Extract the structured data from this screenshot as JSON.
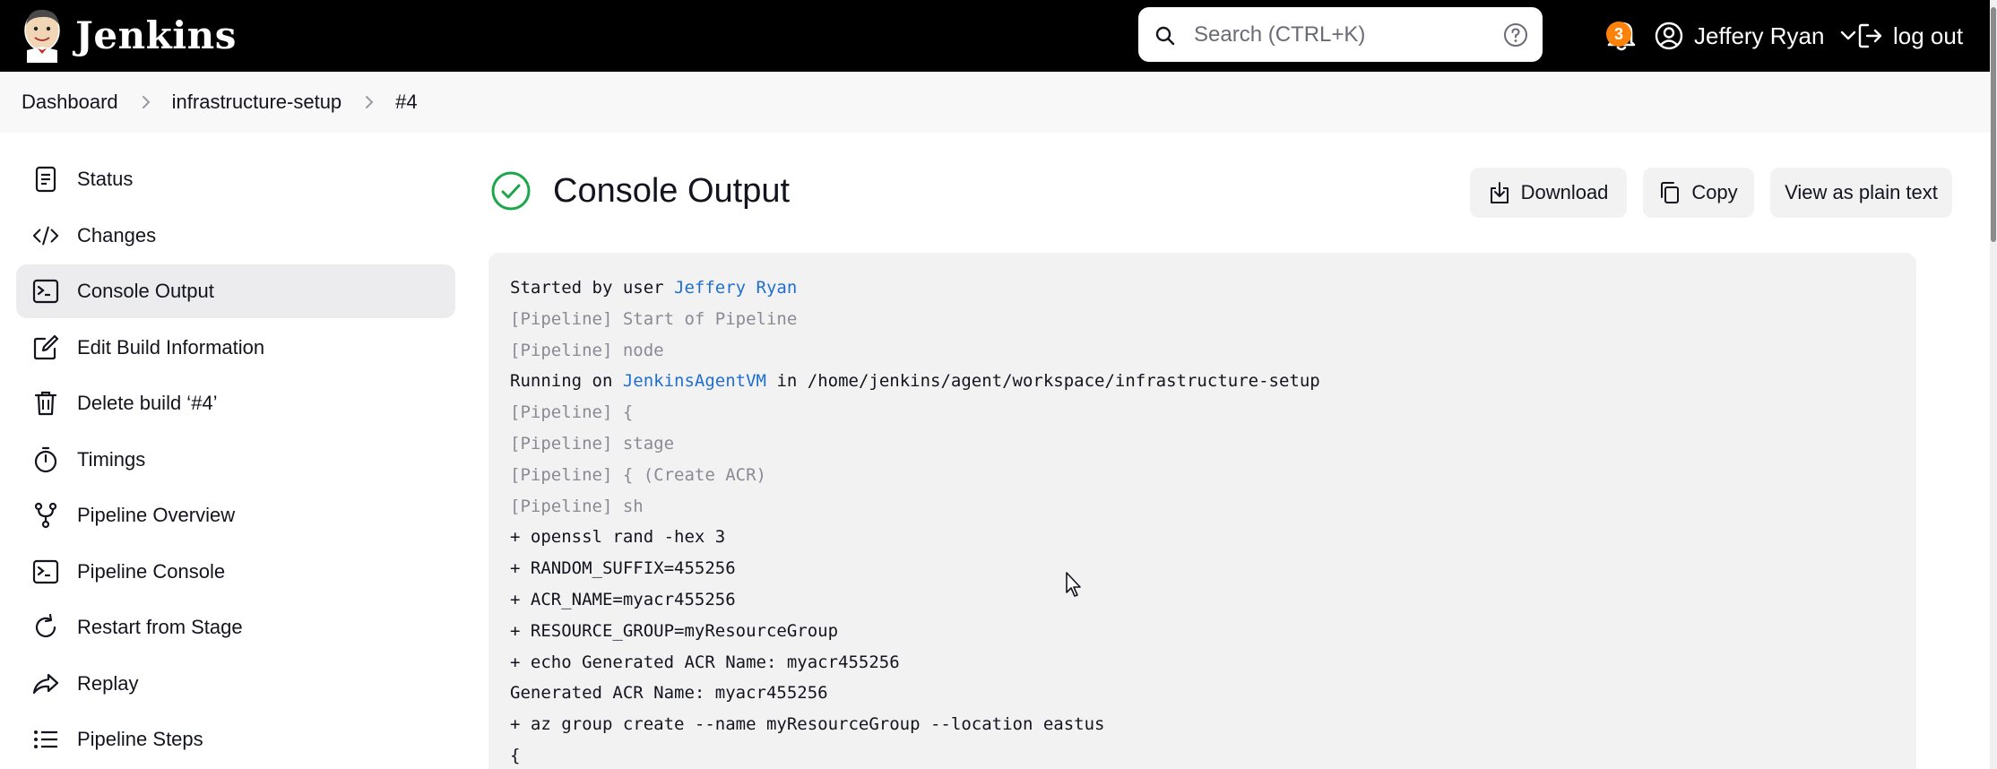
{
  "header": {
    "logo_text": "Jenkins",
    "search_placeholder": "Search (CTRL+K)",
    "notification_count": "3",
    "user_name": "Jeffery Ryan",
    "logout_label": "log out",
    "badge_color": "#fe820a"
  },
  "breadcrumb": [
    {
      "label": "Dashboard"
    },
    {
      "label": "infrastructure-setup"
    },
    {
      "label": "#4"
    }
  ],
  "sidebar": {
    "items": [
      {
        "label": "Status",
        "icon": "document-icon"
      },
      {
        "label": "Changes",
        "icon": "code-icon"
      },
      {
        "label": "Console Output",
        "icon": "terminal-icon",
        "active": true
      },
      {
        "label": "Edit Build Information",
        "icon": "edit-icon"
      },
      {
        "label": "Delete build ‘#4’",
        "icon": "trash-icon"
      },
      {
        "label": "Timings",
        "icon": "stopwatch-icon"
      },
      {
        "label": "Pipeline Overview",
        "icon": "branch-icon"
      },
      {
        "label": "Pipeline Console",
        "icon": "terminal-icon"
      },
      {
        "label": "Restart from Stage",
        "icon": "restart-icon"
      },
      {
        "label": "Replay",
        "icon": "replay-icon"
      },
      {
        "label": "Pipeline Steps",
        "icon": "list-icon"
      }
    ]
  },
  "main": {
    "title": "Console Output",
    "status": "success",
    "status_color": "#1ea64b",
    "buttons": {
      "download": "Download",
      "copy": "Copy",
      "plain_text": "View as plain text"
    }
  },
  "console": {
    "lines": [
      {
        "pre": "Started by user ",
        "link": "Jeffery Ryan",
        "post": "",
        "muted": false
      },
      {
        "pre": "[Pipeline] Start of Pipeline",
        "link": "",
        "post": "",
        "muted": true
      },
      {
        "pre": "[Pipeline] node",
        "link": "",
        "post": "",
        "muted": true
      },
      {
        "pre": "Running on ",
        "link": "JenkinsAgentVM",
        "post": " in /home/jenkins/agent/workspace/infrastructure-setup",
        "muted": false
      },
      {
        "pre": "[Pipeline] {",
        "link": "",
        "post": "",
        "muted": true
      },
      {
        "pre": "[Pipeline] stage",
        "link": "",
        "post": "",
        "muted": true
      },
      {
        "pre": "[Pipeline] { (Create ACR)",
        "link": "",
        "post": "",
        "muted": true
      },
      {
        "pre": "[Pipeline] sh",
        "link": "",
        "post": "",
        "muted": true
      },
      {
        "pre": "+ openssl rand -hex 3",
        "link": "",
        "post": "",
        "muted": false
      },
      {
        "pre": "+ RANDOM_SUFFIX=455256",
        "link": "",
        "post": "",
        "muted": false
      },
      {
        "pre": "+ ACR_NAME=myacr455256",
        "link": "",
        "post": "",
        "muted": false
      },
      {
        "pre": "+ RESOURCE_GROUP=myResourceGroup",
        "link": "",
        "post": "",
        "muted": false
      },
      {
        "pre": "+ echo Generated ACR Name: myacr455256",
        "link": "",
        "post": "",
        "muted": false
      },
      {
        "pre": "Generated ACR Name: myacr455256",
        "link": "",
        "post": "",
        "muted": false
      },
      {
        "pre": "+ az group create --name myResourceGroup --location eastus",
        "link": "",
        "post": "",
        "muted": false
      },
      {
        "pre": "{",
        "link": "",
        "post": "",
        "muted": false
      }
    ]
  },
  "colors": {
    "link": "#1f6fcf",
    "header_bg": "#000000",
    "console_bg": "#f2f2f3"
  }
}
